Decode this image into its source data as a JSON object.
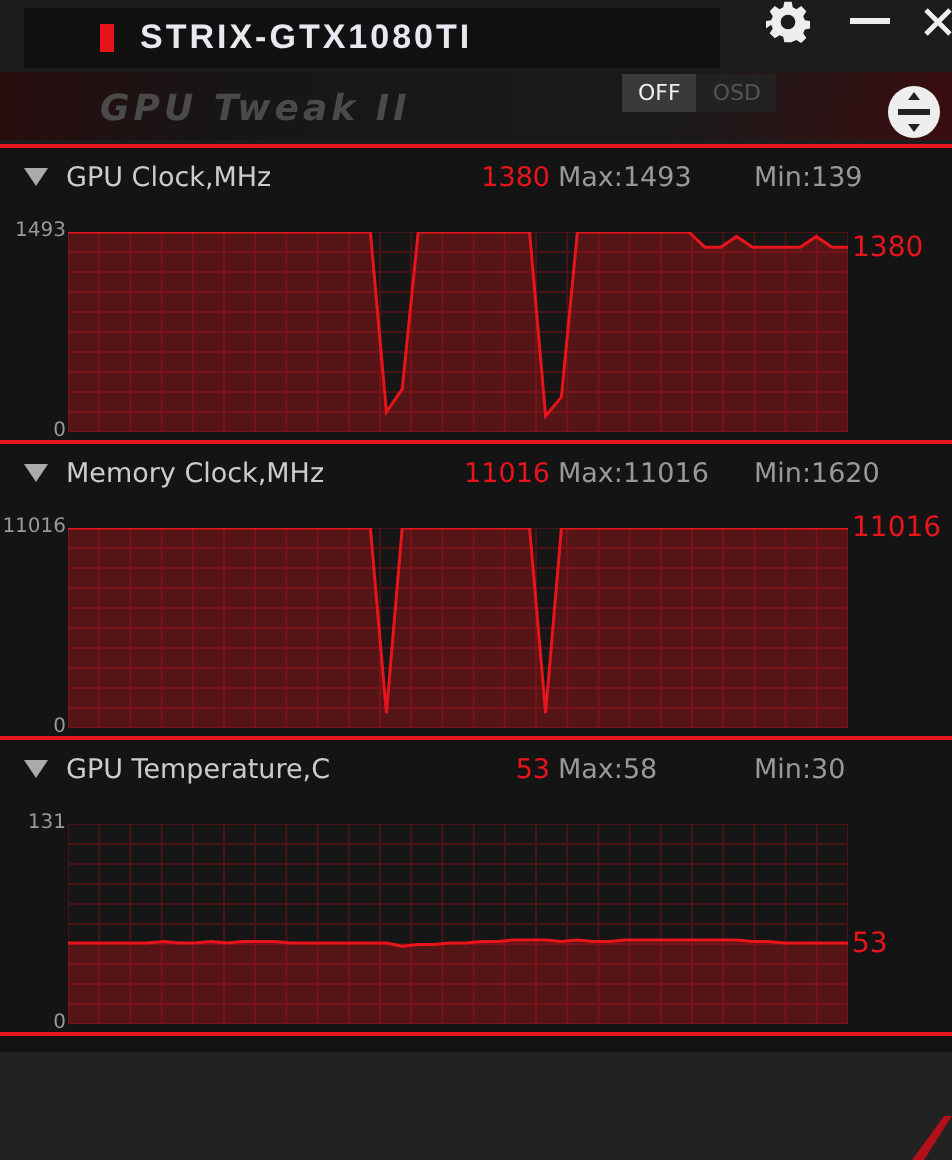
{
  "window": {
    "title": "STRIX-GTX1080TI",
    "brand": "GPU Tweak II"
  },
  "osd_toggle": [
    {
      "label": "OFF",
      "selected": true
    },
    {
      "label": "OSD",
      "selected": false
    }
  ],
  "panels": [
    {
      "title": "GPU Clock,MHz",
      "value": "1380",
      "max": "Max:1493",
      "min": "Min:139",
      "expanded": true,
      "current_label": "1380",
      "chart_data": {
        "type": "area",
        "grid": true,
        "ylim": [
          0,
          1493
        ],
        "yticks": [
          0,
          1493
        ],
        "series": [
          {
            "color": "#e8141c",
            "values": [
              1493,
              1493,
              1493,
              1493,
              1493,
              1493,
              1493,
              1493,
              1493,
              1493,
              1493,
              1493,
              1493,
              1493,
              1493,
              1493,
              1493,
              1493,
              1493,
              1493,
              150,
              320,
              1493,
              1493,
              1493,
              1493,
              1493,
              1493,
              1493,
              1493,
              120,
              260,
              1493,
              1493,
              1493,
              1493,
              1493,
              1493,
              1493,
              1493,
              1380,
              1380,
              1460,
              1380,
              1380,
              1380,
              1380,
              1460,
              1380,
              1380
            ]
          }
        ]
      }
    },
    {
      "title": "Memory Clock,MHz",
      "value": "11016",
      "max": "Max:11016",
      "min": "Min:1620",
      "expanded": true,
      "current_label": "11016",
      "chart_data": {
        "type": "area",
        "grid": true,
        "ylim": [
          0,
          11016
        ],
        "yticks": [
          0,
          11016
        ],
        "series": [
          {
            "color": "#e8141c",
            "values": [
              11016,
              11016,
              11016,
              11016,
              11016,
              11016,
              11016,
              11016,
              11016,
              11016,
              11016,
              11016,
              11016,
              11016,
              11016,
              11016,
              11016,
              11016,
              11016,
              11016,
              810,
              11016,
              11016,
              11016,
              11016,
              11016,
              11016,
              11016,
              11016,
              11016,
              810,
              11016,
              11016,
              11016,
              11016,
              11016,
              11016,
              11016,
              11016,
              11016,
              11016,
              11016,
              11016,
              11016,
              11016,
              11016,
              11016,
              11016,
              11016,
              11016
            ]
          }
        ]
      }
    },
    {
      "title": "GPU Temperature,C",
      "value": "53",
      "max": "Max:58",
      "min": "Min:30",
      "expanded": true,
      "current_label": "53",
      "chart_data": {
        "type": "area",
        "grid": true,
        "ylim": [
          0,
          131
        ],
        "yticks": [
          0,
          131
        ],
        "series": [
          {
            "color": "#e8141c",
            "values": [
              53,
              53,
              53,
              53,
              53,
              53,
              54,
              53,
              53,
              54,
              53,
              54,
              54,
              54,
              53,
              53,
              53,
              53,
              53,
              53,
              53,
              51,
              52,
              52,
              53,
              53,
              54,
              54,
              55,
              55,
              55,
              54,
              55,
              54,
              54,
              55,
              55,
              55,
              55,
              55,
              55,
              55,
              55,
              54,
              54,
              53,
              53,
              53,
              53,
              53
            ]
          }
        ]
      }
    }
  ]
}
